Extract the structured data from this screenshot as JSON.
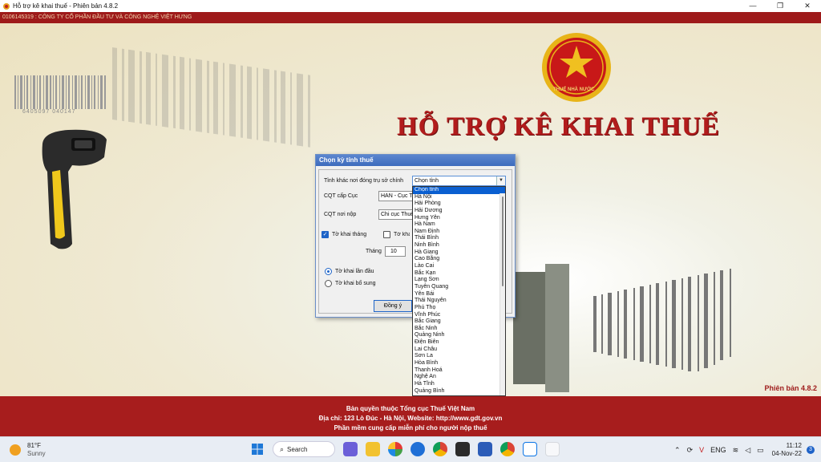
{
  "window": {
    "title": "Hỗ trợ kê khai thuế -  Phiên bản 4.8.2",
    "controls": {
      "minimize": "—",
      "restore": "❐",
      "close": "✕"
    }
  },
  "company_bar": "0106145319 : CÔNG TY CỔ PHẦN ĐẦU TƯ VÀ CÔNG NGHỆ VIỆT HƯNG",
  "main": {
    "title": "HỖ TRỢ KÊ KHAI THUẾ",
    "emblem_text": "THUẾ NHÀ NƯỚC",
    "barcode_number": "6405097 040147",
    "version": "Phiên bản 4.8.2"
  },
  "dialog": {
    "title": "Chọn kỳ tính thuế",
    "tinh_label": "Tỉnh khác nơi đóng trụ sở chính",
    "tinh_value": "Chọn tỉnh",
    "cqt_cap_cuc_label": "CQT cấp Cục",
    "cqt_cap_cuc_value": "HAN - Cục Thuế TP Hà Nội",
    "cqt_noi_nop_label": "CQT nơi nộp",
    "cqt_noi_nop_value": "Chi cục Thuế Quận Cầu Giấy",
    "to_khai_thang_label": "Tờ khai tháng",
    "to_khai_quy_label": "Tờ khai quý",
    "thang_label": "Tháng",
    "thang_value": "10",
    "lan_dau_label": "Tờ khai lần đầu",
    "bo_sung_label": "Tờ khai bổ sung",
    "ok_label": "Đồng ý"
  },
  "dropdown": {
    "items": [
      "Chọn tỉnh",
      "Hà Nội",
      "Hải Phòng",
      "Hải Dương",
      "Hưng Yên",
      "Hà Nam",
      "Nam Định",
      "Thái Bình",
      "Ninh Bình",
      "Hà Giang",
      "Cao Bằng",
      "Lào Cai",
      "Bắc Kạn",
      "Lạng Sơn",
      "Tuyên Quang",
      "Yên Bái",
      "Thái Nguyên",
      "Phú Thọ",
      "Vĩnh Phúc",
      "Bắc Giang",
      "Bắc Ninh",
      "Quảng Ninh",
      "Điện Biên",
      "Lai Châu",
      "Sơn La",
      "Hòa Bình",
      "Thanh Hoá",
      "Nghệ An",
      "Hà Tĩnh",
      "Quảng Bình"
    ],
    "selected_index": 0
  },
  "footer": {
    "line1": "Bản quyền thuộc Tổng cục Thuế Việt Nam",
    "line2": "Địa chỉ: 123 Lò Đúc - Hà Nội, Website: http://www.gdt.gov.vn",
    "line3": "Phần mềm cung cấp miễn phí cho người nộp thuế"
  },
  "taskbar": {
    "weather_temp": "81°F",
    "weather_desc": "Sunny",
    "search_label": "Search",
    "lang": "ENG",
    "time": "11:12",
    "date": "04-Nov-22",
    "notifications": "3",
    "pinned_icons": [
      "windows-start-icon",
      "meet-icon",
      "file-explorer-icon",
      "pinwheel-icon",
      "teamviewer-icon",
      "chrome-icon",
      "sticky-notes-icon",
      "word-icon",
      "chrome-profile-icon",
      "zalo-icon",
      "blank-app-icon"
    ]
  },
  "colors": {
    "brand_red": "#a71d1d",
    "title_red": "#b21c1c",
    "dialog_blue": "#3d6bbd",
    "selection_blue": "#0a5fd1"
  }
}
